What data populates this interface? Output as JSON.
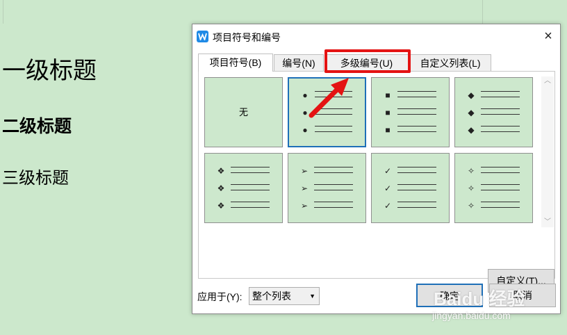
{
  "document": {
    "heading1": "一级标题",
    "heading2": "二级标题",
    "heading3": "三级标题"
  },
  "dialog": {
    "title": "项目符号和编号",
    "close": "×",
    "tabs": [
      "项目符号(B)",
      "编号(N)",
      "多级编号(U)",
      "自定义列表(L)"
    ],
    "active_tab": "项目符号(B)",
    "highlighted_tab": "多级编号(U)",
    "none_label": "无",
    "bullet_cells": [
      {
        "symbol": "●",
        "icon": "filled-circle-bullet-icon",
        "selected": true
      },
      {
        "symbol": "■",
        "icon": "filled-square-bullet-icon",
        "selected": false
      },
      {
        "symbol": "◆",
        "icon": "filled-diamond-bullet-icon",
        "selected": false
      },
      {
        "symbol": "❖",
        "icon": "four-diamond-bullet-icon",
        "selected": false
      },
      {
        "symbol": "➢",
        "icon": "arrowhead-bullet-icon",
        "selected": false
      },
      {
        "symbol": "✓",
        "icon": "checkmark-bullet-icon",
        "selected": false
      },
      {
        "symbol": "✧",
        "icon": "four-point-star-bullet-icon",
        "selected": false
      }
    ],
    "custom_button": "自定义(T)...",
    "apply_label": "应用于(Y):",
    "apply_value": "整个列表",
    "ok_button": "确定",
    "cancel_button": "取消"
  },
  "watermark": {
    "text": "Baidu 经验",
    "url": "jingyan.baidu.com"
  },
  "colors": {
    "doc_background": "#cce8cc",
    "highlight_red": "#e41313",
    "selection_blue": "#1e6fb8",
    "app_icon_blue": "#1f8ae6"
  }
}
